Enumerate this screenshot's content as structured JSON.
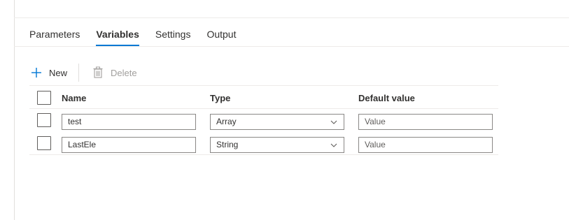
{
  "tabs": [
    {
      "label": "Parameters",
      "active": false
    },
    {
      "label": "Variables",
      "active": true
    },
    {
      "label": "Settings",
      "active": false
    },
    {
      "label": "Output",
      "active": false
    }
  ],
  "toolbar": {
    "new_label": "New",
    "new_icon": "plus-icon",
    "delete_label": "Delete",
    "delete_icon": "trash-icon"
  },
  "table": {
    "columns": [
      "Name",
      "Type",
      "Default value"
    ],
    "rows": [
      {
        "name": "test",
        "type": "Array",
        "default_placeholder": "Value"
      },
      {
        "name": "LastEle",
        "type": "String",
        "default_placeholder": "Value"
      }
    ]
  },
  "colors": {
    "accent": "#0078d4",
    "disabled_text": "#a19f9d",
    "border": "#8a8886"
  }
}
